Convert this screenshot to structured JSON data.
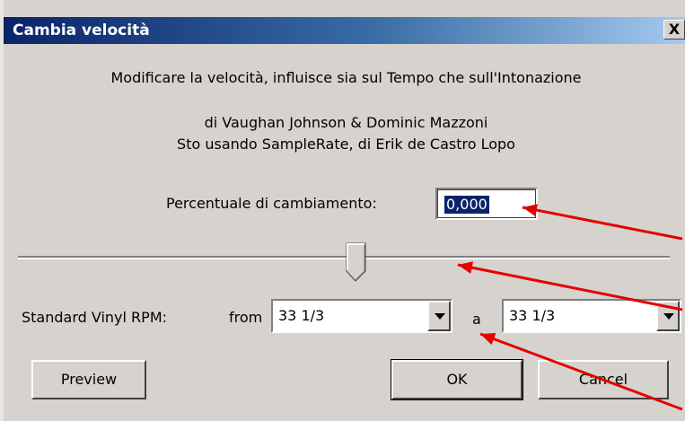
{
  "window": {
    "title": "Cambia velocità",
    "close_glyph": "X"
  },
  "info": {
    "line1": "Modificare la velocità, influisce sia sul Tempo che sull'Intonazione",
    "line2": "di Vaughan Johnson & Dominic Mazzoni",
    "line3": "Sto usando SampleRate, di Erik de Castro Lopo"
  },
  "percent": {
    "label": "Percentuale di cambiamento:",
    "value": "0,000"
  },
  "slider": {
    "value": 0
  },
  "vinyl": {
    "label": "Standard Vinyl RPM:",
    "from_label": "from",
    "from_value": "33 1/3",
    "to_label": "a",
    "to_value": "33 1/3"
  },
  "buttons": {
    "preview": "Preview",
    "ok": "OK",
    "cancel": "Cancel"
  },
  "annotation_color": "#e60000"
}
